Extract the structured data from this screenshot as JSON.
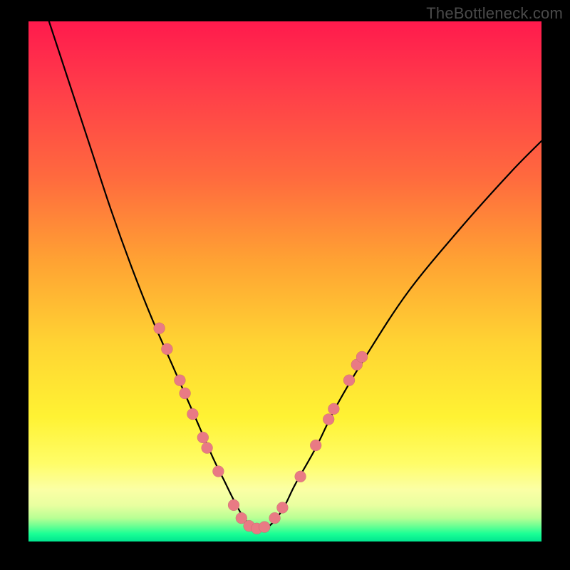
{
  "watermark": "TheBottleneck.com",
  "colors": {
    "frame_bg": "#000000",
    "watermark_text": "#4a4a4a",
    "curve_stroke": "#000000",
    "marker_fill": "#e97a84",
    "gradient_stops": [
      "#ff1a4d",
      "#ff3a4a",
      "#ff6a3e",
      "#ffa233",
      "#ffd433",
      "#fff233",
      "#fffd68",
      "#fbffa5",
      "#e9ffa0",
      "#b8ff94",
      "#6dff93",
      "#1aff95",
      "#00e58f"
    ]
  },
  "chart_data": {
    "type": "line",
    "title": "",
    "xlabel": "",
    "ylabel": "",
    "x_range": [
      0,
      100
    ],
    "y_range": [
      0,
      100
    ],
    "note": "Unlabeled axes; values are normalized 0–100 based on plot-area pixel position (y=0 bottom, y=100 top). Curve is a V-shaped bottleneck curve with minimum near x≈44.",
    "series": [
      {
        "name": "bottleneck-curve",
        "x": [
          4,
          8,
          12,
          16,
          20,
          24,
          28,
          32,
          36,
          38,
          40,
          42,
          44,
          46,
          48,
          50,
          52,
          56,
          60,
          66,
          74,
          84,
          94,
          100
        ],
        "y": [
          100,
          88,
          76,
          64,
          53,
          43,
          34,
          25,
          16,
          12,
          8,
          4.5,
          2.5,
          2.5,
          4,
          7,
          11,
          18,
          26,
          36,
          48,
          60,
          71,
          77
        ]
      }
    ],
    "markers": {
      "name": "highlighted-points",
      "note": "Pink filled circular markers along the curve near the trough region.",
      "points": [
        {
          "x": 25.5,
          "y": 41.0
        },
        {
          "x": 27.0,
          "y": 37.0
        },
        {
          "x": 29.5,
          "y": 31.0
        },
        {
          "x": 30.5,
          "y": 28.5
        },
        {
          "x": 32.0,
          "y": 24.5
        },
        {
          "x": 34.0,
          "y": 20.0
        },
        {
          "x": 34.8,
          "y": 18.0
        },
        {
          "x": 37.0,
          "y": 13.5
        },
        {
          "x": 40.0,
          "y": 7.0
        },
        {
          "x": 41.5,
          "y": 4.5
        },
        {
          "x": 43.0,
          "y": 3.0
        },
        {
          "x": 44.5,
          "y": 2.5
        },
        {
          "x": 46.0,
          "y": 2.8
        },
        {
          "x": 48.0,
          "y": 4.5
        },
        {
          "x": 49.5,
          "y": 6.5
        },
        {
          "x": 53.0,
          "y": 12.5
        },
        {
          "x": 56.0,
          "y": 18.5
        },
        {
          "x": 58.5,
          "y": 23.5
        },
        {
          "x": 59.5,
          "y": 25.5
        },
        {
          "x": 62.5,
          "y": 31.0
        },
        {
          "x": 64.0,
          "y": 34.0
        },
        {
          "x": 65.0,
          "y": 35.5
        }
      ],
      "radius": 8
    }
  }
}
